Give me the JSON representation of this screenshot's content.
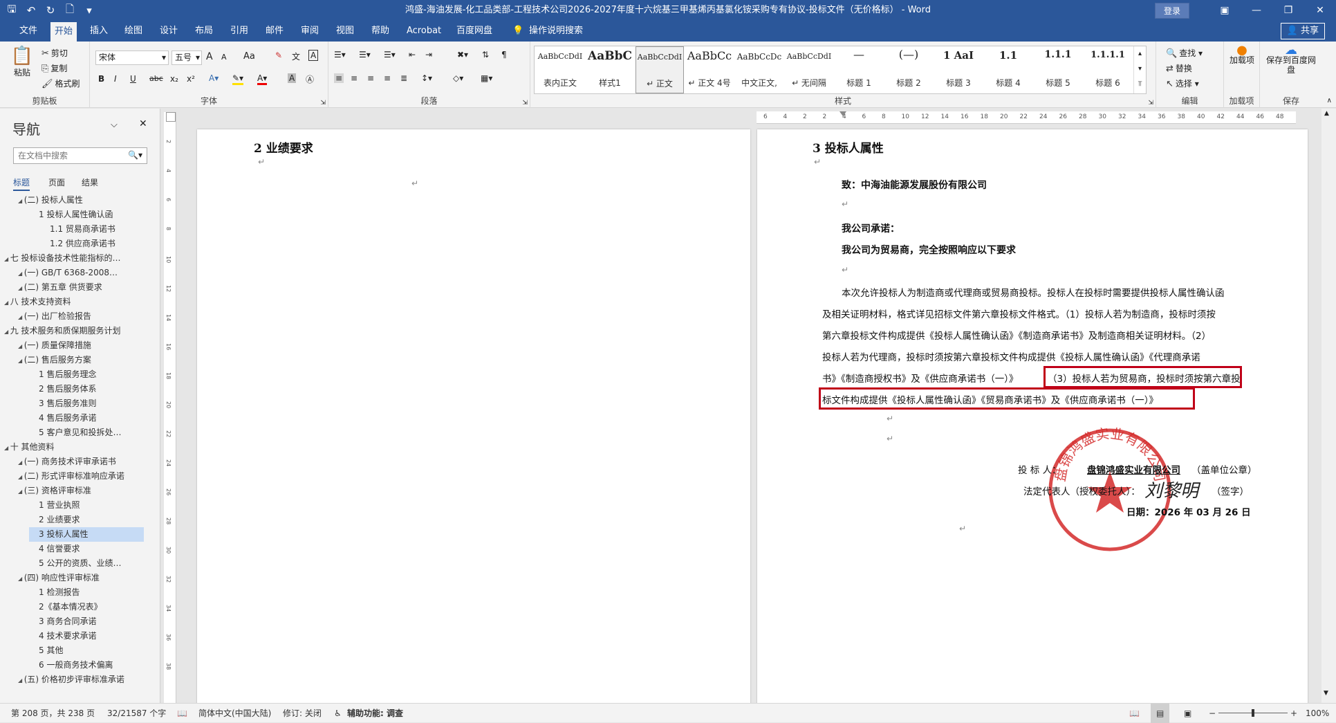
{
  "window": {
    "title": "鸿盛-海油发展-化工品类部-工程技术公司2026-2027年度十六烷基三甲基烯丙基氯化铵采购专有协议-投标文件（无价格标） - Word",
    "login_label": "登录"
  },
  "tabs": [
    {
      "label": "文件"
    },
    {
      "label": "开始",
      "active": true
    },
    {
      "label": "插入"
    },
    {
      "label": "绘图"
    },
    {
      "label": "设计"
    },
    {
      "label": "布局"
    },
    {
      "label": "引用"
    },
    {
      "label": "邮件"
    },
    {
      "label": "审阅"
    },
    {
      "label": "视图"
    },
    {
      "label": "帮助"
    },
    {
      "label": "Acrobat"
    },
    {
      "label": "百度网盘"
    },
    {
      "label": "操作说明搜索"
    }
  ],
  "share_label": "共享",
  "ribbon": {
    "clipboard": {
      "paste": "粘贴",
      "cut": "剪切",
      "copy": "复制",
      "format_painter": "格式刷",
      "label": "剪贴板"
    },
    "font": {
      "name": "宋体",
      "size": "五号",
      "label": "字体",
      "bold": "B",
      "italic": "I",
      "underline": "U",
      "strike": "abc",
      "sub": "x₂",
      "sup": "x²",
      "grow": "A",
      "shrink": "A",
      "case": "Aa"
    },
    "paragraph": {
      "label": "段落"
    },
    "styles": {
      "label": "样式",
      "items": [
        {
          "sample": "AaBbCcDdI",
          "name": "表内正文"
        },
        {
          "sample": "AaBbC",
          "name": "样式1"
        },
        {
          "sample": "AaBbCcDdI",
          "name": "↵ 正文",
          "selected": true
        },
        {
          "sample": "AaBbCc",
          "name": "↵ 正文 4号"
        },
        {
          "sample": "AaBbCcDc",
          "name": "中文正文,"
        },
        {
          "sample": "AaBbCcDdI",
          "name": "↵ 无间隔"
        },
        {
          "sample": "—",
          "name": "标题 1"
        },
        {
          "sample": "(—)",
          "name": "标题 2"
        },
        {
          "sample": "1 AaI",
          "name": "标题 3"
        },
        {
          "sample": "1.1",
          "name": "标题 4"
        },
        {
          "sample": "1.1.1",
          "name": "标题 5"
        },
        {
          "sample": "1.1.1.1",
          "name": "标题 6"
        }
      ]
    },
    "editing": {
      "find": "查找",
      "replace": "替换",
      "select": "选择",
      "label": "编辑"
    },
    "addins": {
      "button": "加载项",
      "label": "加载项"
    },
    "baidu": {
      "button": "保存到百度网盘",
      "label": "保存"
    }
  },
  "nav": {
    "title": "导航",
    "search_placeholder": "在文档中搜索",
    "tabs": [
      "标题",
      "页面",
      "结果"
    ],
    "items": [
      {
        "label": "(二) 投标人属性",
        "level": 2
      },
      {
        "label": "1 投标人属性确认函",
        "level": 3
      },
      {
        "label": "1.1 贸易商承诺书",
        "level": 4
      },
      {
        "label": "1.2 供应商承诺书",
        "level": 4
      },
      {
        "label": "七 投标设备技术性能指标的…",
        "level": 1
      },
      {
        "label": "(一) GB/T 6368-2008…",
        "level": 2
      },
      {
        "label": "(二) 第五章  供货要求",
        "level": 2
      },
      {
        "label": "八 技术支持资料",
        "level": 1
      },
      {
        "label": "(一) 出厂检验报告",
        "level": 2
      },
      {
        "label": "九 技术服务和质保期服务计划",
        "level": 1
      },
      {
        "label": "(一) 质量保障措施",
        "level": 2
      },
      {
        "label": "(二) 售后服务方案",
        "level": 2
      },
      {
        "label": "1 售后服务理念",
        "level": 3
      },
      {
        "label": "2 售后服务体系",
        "level": 3
      },
      {
        "label": "3 售后服务准则",
        "level": 3
      },
      {
        "label": "4 售后服务承诺",
        "level": 3
      },
      {
        "label": "5 客户意见和投拆处…",
        "level": 3
      },
      {
        "label": "十 其他资料",
        "level": 1
      },
      {
        "label": "(一) 商务技术评审承诺书",
        "level": 2
      },
      {
        "label": "(二) 形式评审标准响应承诺",
        "level": 2
      },
      {
        "label": "(三) 资格评审标准",
        "level": 2
      },
      {
        "label": "1 营业执照",
        "level": 3
      },
      {
        "label": "2 业绩要求",
        "level": 3
      },
      {
        "label": "3 投标人属性",
        "level": 3,
        "selected": true
      },
      {
        "label": "4 信誉要求",
        "level": 3
      },
      {
        "label": "5 公开的资质、业绩…",
        "level": 3
      },
      {
        "label": "(四) 响应性评审标准",
        "level": 2
      },
      {
        "label": "1 检测报告",
        "level": 3
      },
      {
        "label": "2《基本情况表》",
        "level": 3
      },
      {
        "label": "3 商务合同承诺",
        "level": 3
      },
      {
        "label": "4 技术要求承诺",
        "level": 3
      },
      {
        "label": "5 其他",
        "level": 3
      },
      {
        "label": "6 一般商务技术偏离",
        "level": 3
      },
      {
        "label": "(五) 价格初步评审标准承诺",
        "level": 2
      }
    ]
  },
  "ruler": {
    "ticks": [
      "6",
      "4",
      "2",
      "2",
      "4",
      "6",
      "8",
      "10",
      "12",
      "14",
      "16",
      "18",
      "20",
      "22",
      "24",
      "26",
      "28",
      "30",
      "32",
      "34",
      "36",
      "38",
      "40",
      "42",
      "44",
      "46",
      "48"
    ],
    "vticks": [
      "2",
      "4",
      "6",
      "8",
      "10",
      "12",
      "14",
      "16",
      "18",
      "20",
      "22",
      "24",
      "26",
      "28",
      "30",
      "32",
      "34",
      "36",
      "38"
    ]
  },
  "doc": {
    "left_heading": "2   业绩要求",
    "right_heading": "3   投标人属性",
    "to_line": "致：中海油能源发展股份有限公司",
    "commit_label": "我公司承诺：",
    "commit_text": "我公司为贸易商，完全按照响应以下要求",
    "body_lines": [
      "本次允许投标人为制造商或代理商或贸易商投标。投标人在投标时需要提供投标人属性确认函",
      "及相关证明材料，格式详见招标文件第六章投标文件格式。（1）投标人若为制造商，投标时须按",
      "第六章投标文件构成提供《投标人属性确认函》《制造商承诺书》及制造商相关证明材料。（2）",
      "投标人若为代理商，投标时须按第六章投标文件构成提供《投标人属性确认函》《代理商承诺"
    ],
    "line5_left": "书》《制造商授权书》及《供应商承诺书（一）》",
    "line5_right": "（3）投标人若为贸易商，投标时须按第六章投",
    "line6": "标文件构成提供《投标人属性确认函》《贸易商承诺书》及《供应商承诺书（一）》",
    "bidder_label": "投    标    人：",
    "bidder_name": "盘锦鸿盛实业有限公司",
    "bidder_suffix": "（盖单位公章）",
    "rep_label": "法定代表人（授权委托人）：",
    "rep_sign": "刘黎明",
    "rep_suffix": "（签字）",
    "date_text": "日期：2026 年 03 月 26 日",
    "seal_text": "盘锦鸿盛实业有限公司"
  },
  "status": {
    "page": "第 208 页，共 238 页",
    "words": "32/21587 个字",
    "lang": "简体中文(中国大陆)",
    "revision": "修订: 关闭",
    "accessibility": "辅助功能: 调查",
    "zoom": "100%"
  },
  "colors": {
    "accent": "#2b579a",
    "highlight_box": "#c00018",
    "seal": "#d42a2a"
  }
}
